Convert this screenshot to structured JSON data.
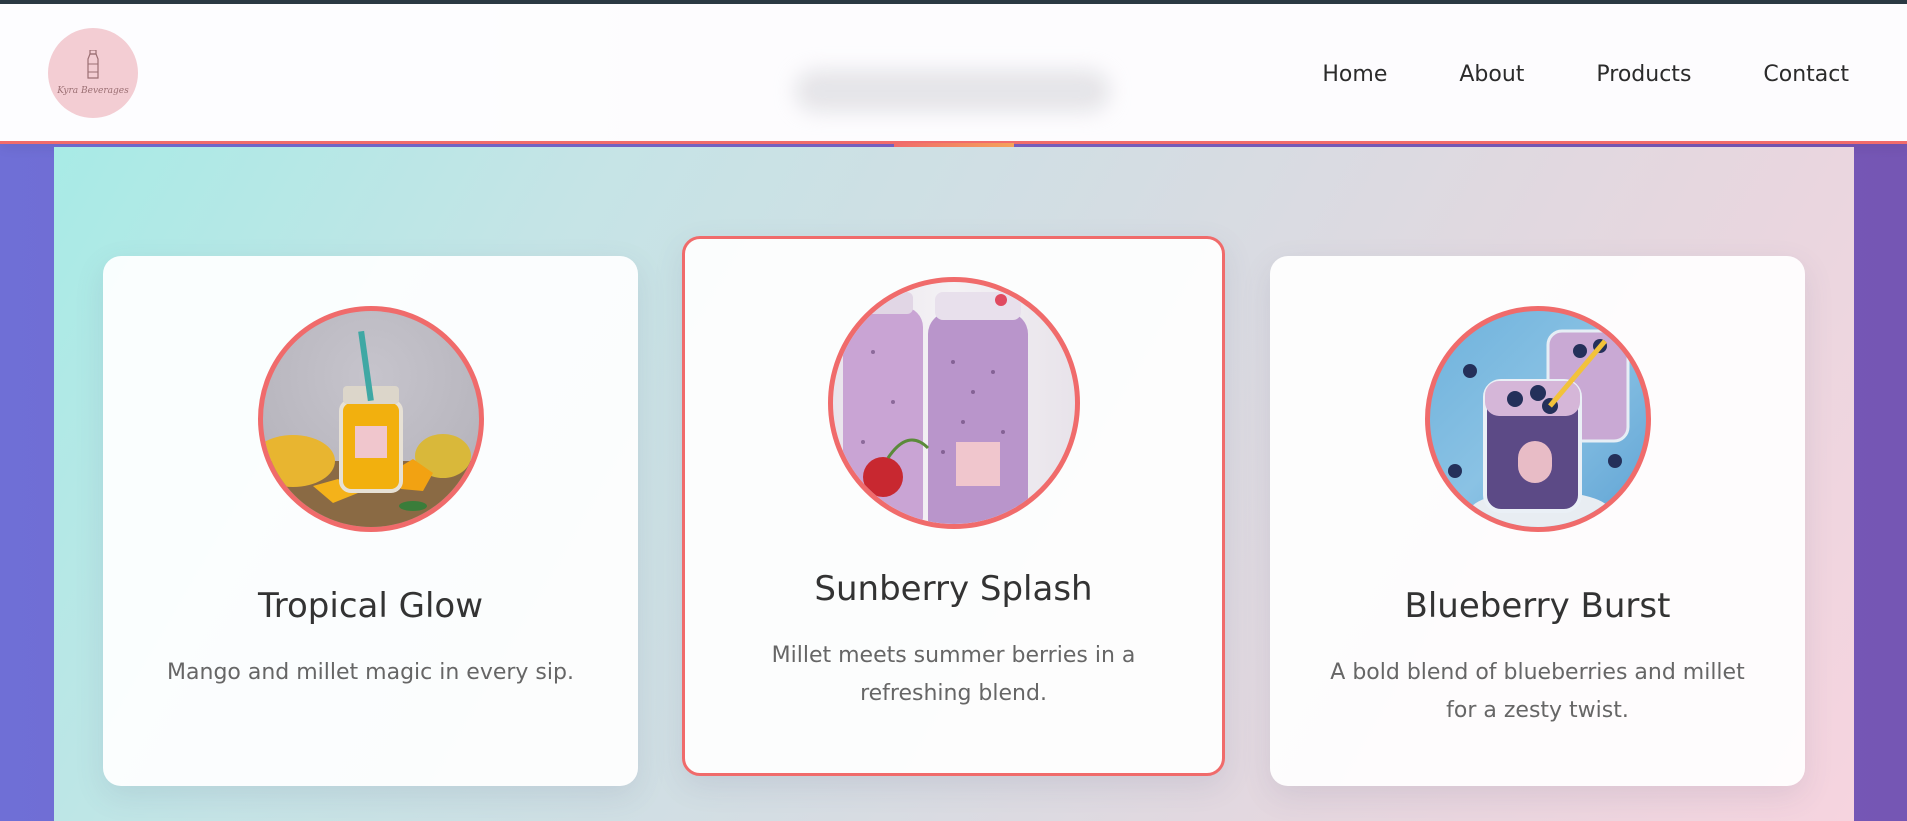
{
  "brand": {
    "logo_text": "Kyra Beverages",
    "accent_color": "#f06b6b"
  },
  "nav": {
    "items": [
      "Home",
      "About",
      "Products",
      "Contact"
    ]
  },
  "products": [
    {
      "title": "Tropical Glow",
      "description": "Mango and millet magic in every sip.",
      "image": "mango-drink-image"
    },
    {
      "title": "Sunberry Splash",
      "description": "Millet meets summer berries in a refreshing blend.",
      "image": "berry-drink-image"
    },
    {
      "title": "Blueberry Burst",
      "description": "A bold blend of blueberries and millet for a zesty twist.",
      "image": "blueberry-drink-image"
    }
  ]
}
